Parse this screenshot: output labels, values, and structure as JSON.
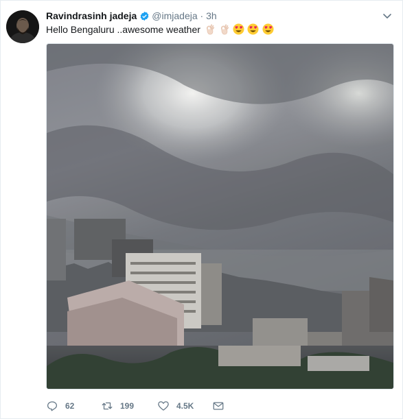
{
  "tweet": {
    "author_name": "Ravindrasinh jadeja",
    "handle": "@imjadeja",
    "separator": "·",
    "time": "3h",
    "text": "Hello Bengaluru ..awesome weather",
    "emojis": [
      "ok-hand",
      "ok-hand",
      "heart-eyes",
      "heart-eyes",
      "heart-eyes"
    ]
  },
  "actions": {
    "replies": "62",
    "retweets": "199",
    "likes": "4.5K"
  },
  "colors": {
    "verified": "#1da1f2",
    "muted_text": "#657786",
    "border": "#e6ecf0"
  },
  "icons": [
    "verified-badge-icon",
    "chevron-down-icon",
    "reply-icon",
    "retweet-icon",
    "like-icon",
    "direct-message-icon"
  ]
}
